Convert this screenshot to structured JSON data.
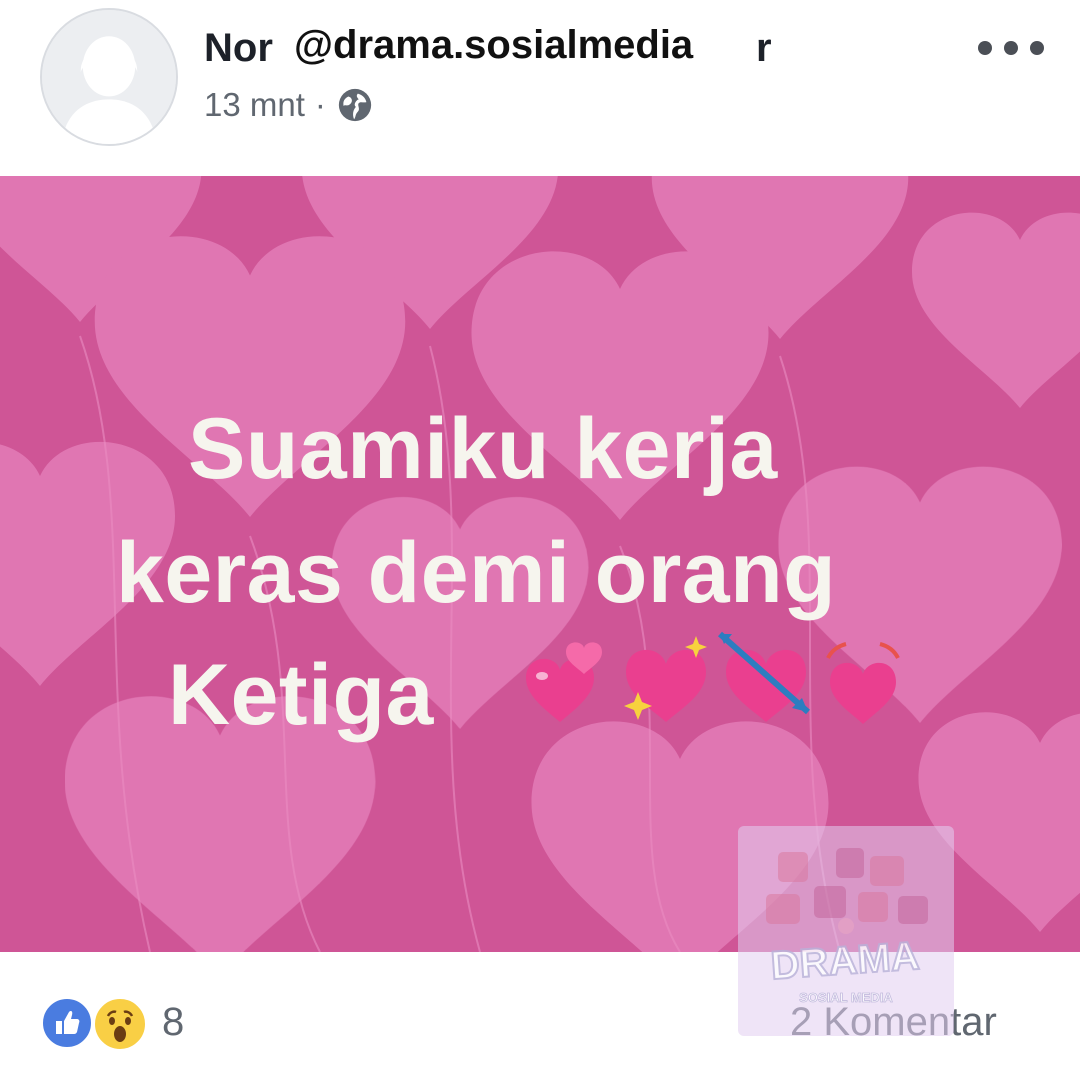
{
  "post": {
    "author_visible_start": "Nor",
    "author_visible_end": "r",
    "watermark_handle": "@drama.sosialmedia",
    "timestamp": "13 mnt",
    "separator": "·",
    "privacy_icon": "globe-icon",
    "more_icon": "more-options-icon",
    "image_text": {
      "line1": "Suamiku kerja",
      "line2": "keras demi orang",
      "line3": "Ketiga"
    },
    "emojis": [
      "two-hearts-icon",
      "sparkling-heart-icon",
      "heart-with-arrow-icon",
      "beating-heart-icon"
    ],
    "image_background_color": "#cf5596",
    "heart_color": "#e27bb6"
  },
  "footer": {
    "reactions": [
      "like-icon",
      "wow-icon"
    ],
    "reaction_count": "8",
    "comment_count": "2 Komentar"
  },
  "watermark_logo": {
    "label": "DRAMA",
    "sub_label": "SOSIAL MEDIA"
  }
}
